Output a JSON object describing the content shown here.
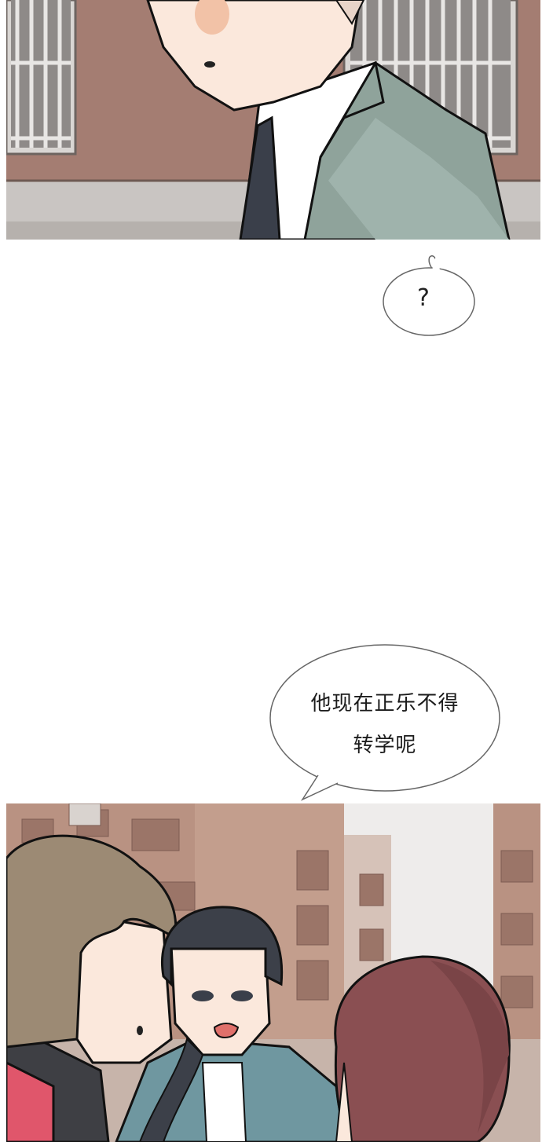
{
  "comic": {
    "panels": [
      {
        "id": "top",
        "scene": "man-in-suit-close-up"
      },
      {
        "id": "bottom",
        "scene": "three-students-in-street"
      }
    ],
    "bubbles": {
      "question": {
        "text": "?"
      },
      "speech": {
        "line1": "他现在正乐不得",
        "line2": "转学呢"
      }
    }
  },
  "colors": {
    "wall": "#a47d72",
    "suit": "#8fa39b",
    "skin": "#fbe8dc",
    "blush": "#f2c2a7",
    "tie": "#3a3f4a",
    "hair_brown": "#9c8a74",
    "hair_red": "#8a4f52",
    "hair_dark": "#3c4049",
    "jacket_blue": "#6f97a0",
    "building": "#b99282"
  }
}
